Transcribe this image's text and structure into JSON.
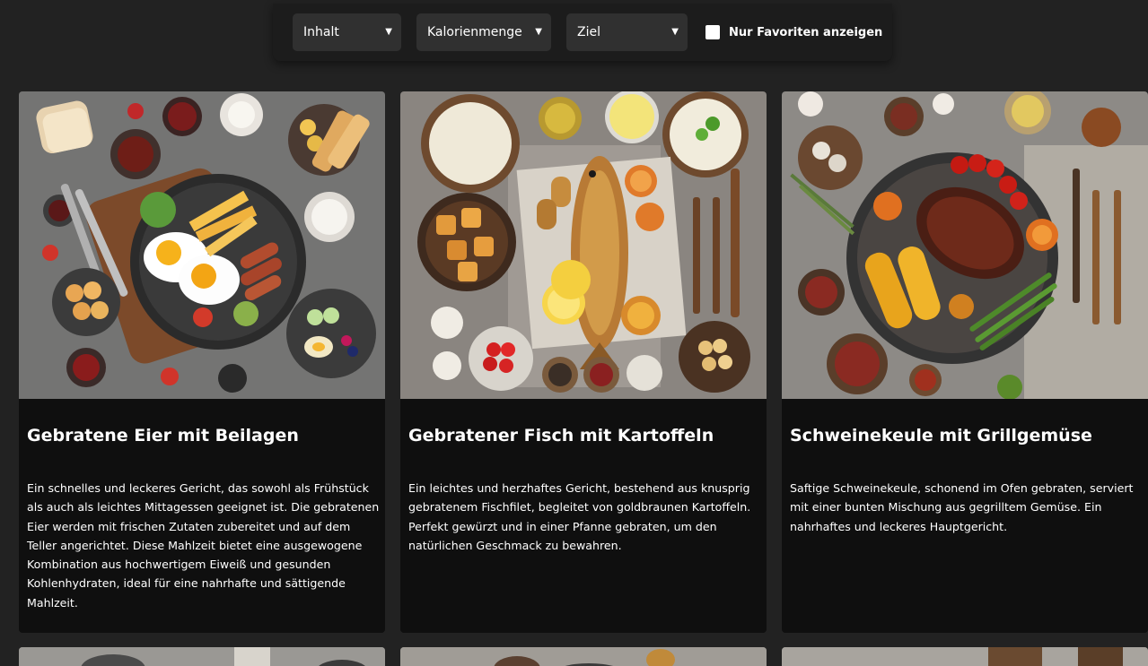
{
  "filters": {
    "content_label": "Inhalt",
    "calories_label": "Kalorienmenge",
    "goal_label": "Ziel",
    "favorites_label": "Nur Favoriten anzeigen",
    "favorites_checked": false
  },
  "cards": [
    {
      "title": "Gebratene Eier mit Beilagen",
      "description": "Ein schnelles und leckeres Gericht, das sowohl als Frühstück als auch als leichtes Mittagessen geeignet ist. Die gebratenen Eier werden mit frischen Zutaten zubereitet und auf dem Teller angerichtet. Diese Mahlzeit bietet eine ausgewogene Kombination aus hochwertigem Eiweiß und gesunden Kohlenhydraten, ideal für eine nahrhafte und sättigende Mahlzeit."
    },
    {
      "title": "Gebratener Fisch mit Kartoffeln",
      "description": "Ein leichtes und herzhaftes Gericht, bestehend aus knusprig gebratenem Fischfilet, begleitet von goldbraunen Kartoffeln. Perfekt gewürzt und in einer Pfanne gebraten, um den natürlichen Geschmack zu bewahren."
    },
    {
      "title": "Schweinekeule mit Grillgemüse",
      "description": "Saftige Schweinekeule, schonend im Ofen gebraten, serviert mit einer bunten Mischung aus gegrilltem Gemüse. Ein nahrhaftes und leckeres Hauptgericht."
    }
  ],
  "colors": {
    "page_background": "#222222",
    "card_background": "#0f0f0f",
    "select_background": "#303030",
    "text": "#ffffff"
  },
  "icons": {
    "select_chevron": "chevron-down-icon"
  }
}
